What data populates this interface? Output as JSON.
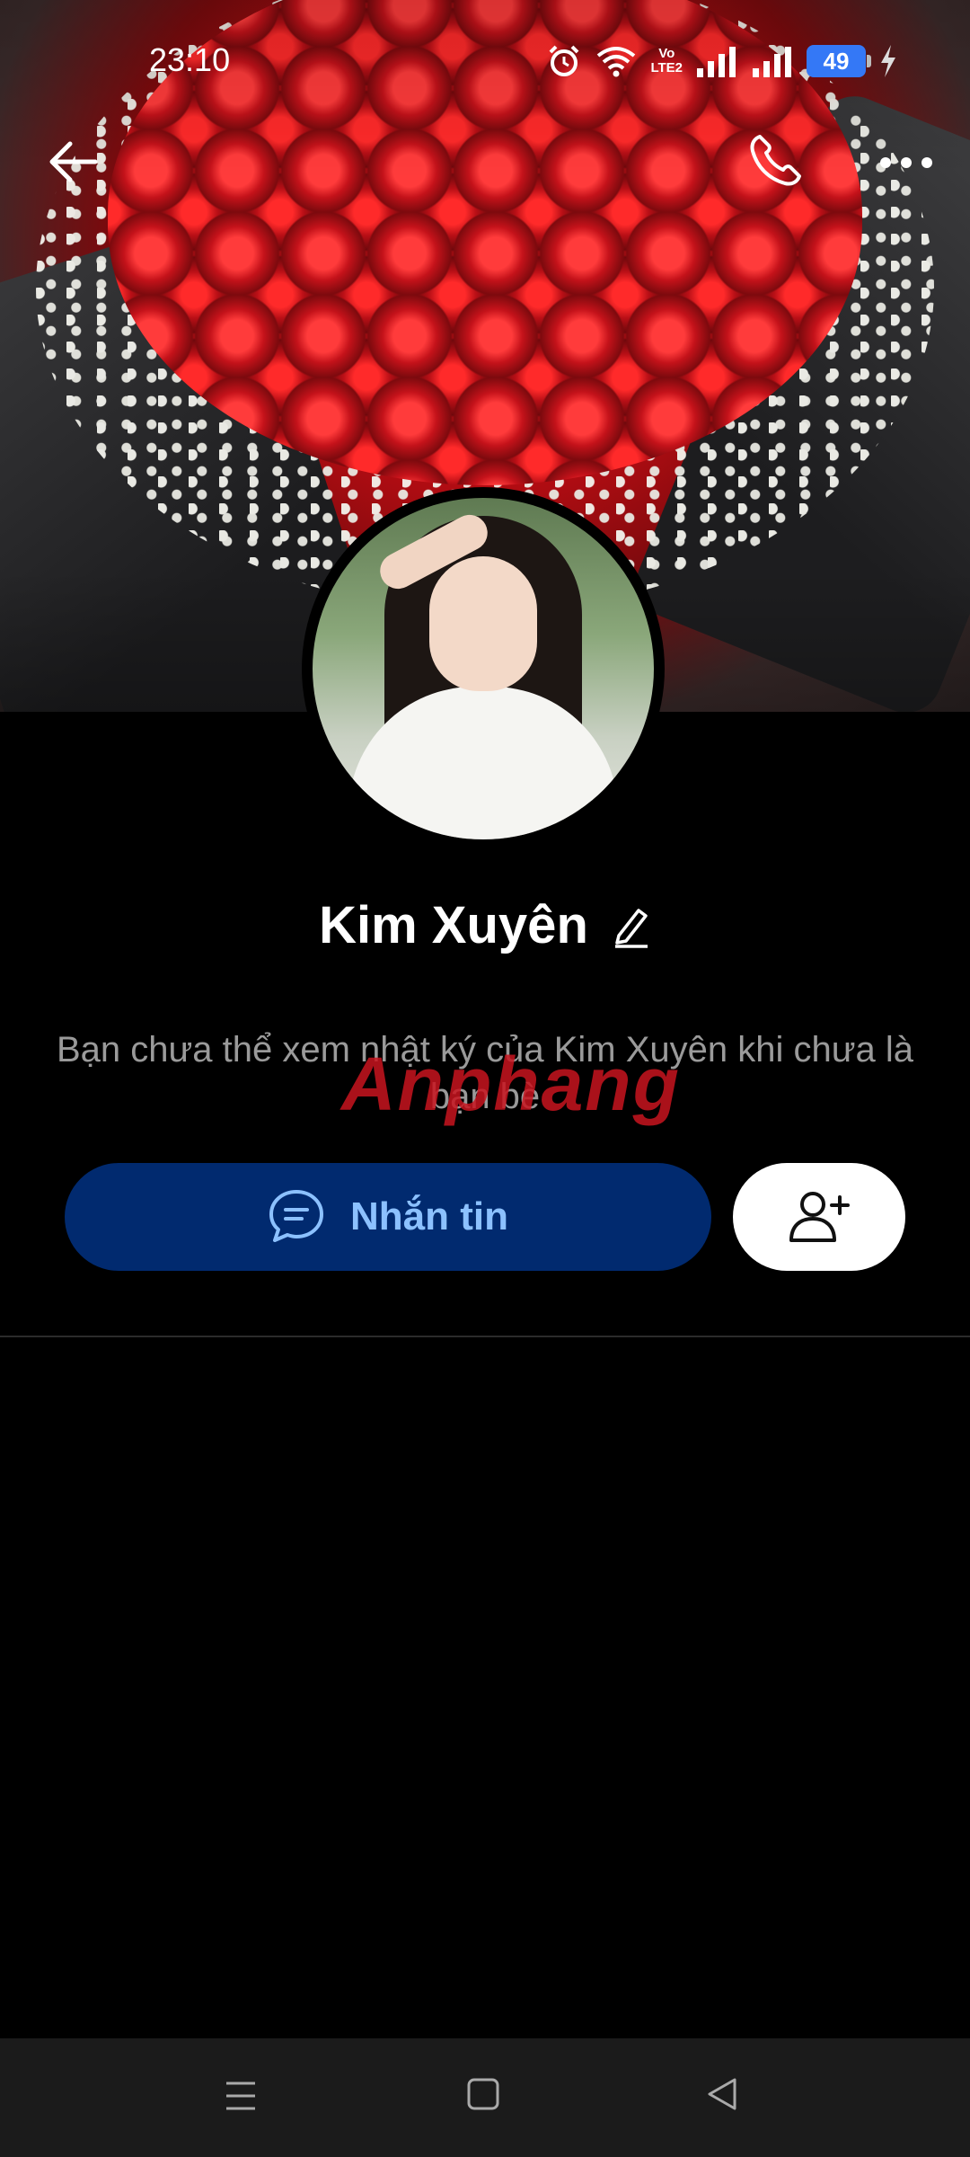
{
  "status_bar": {
    "time": "23:10",
    "network_label": "Vo\nLTE2",
    "battery": "49",
    "icons": [
      "alarm-icon",
      "wifi-icon",
      "volte-icon",
      "signal-icon",
      "signal-icon",
      "battery-icon",
      "charging-icon"
    ]
  },
  "header": {
    "icons": [
      "back-arrow-icon",
      "phone-icon",
      "more-icon"
    ]
  },
  "profile": {
    "name": "Kim Xuyên",
    "info_text": "Bạn chưa thể xem nhật ký của Kim Xuyên khi chưa là bạn bè",
    "watermark": "Anphang"
  },
  "actions": {
    "message_label": "Nhắn tin",
    "add_friend_icon": "add-user-icon"
  },
  "nav_bar": {
    "icons": [
      "menu-icon",
      "home-icon",
      "back-icon"
    ]
  },
  "colors": {
    "background": "#000000",
    "message_button": "#012a6f",
    "message_text": "#8cc1ff",
    "info_text": "#9a9a9a",
    "battery": "#3478f6"
  }
}
